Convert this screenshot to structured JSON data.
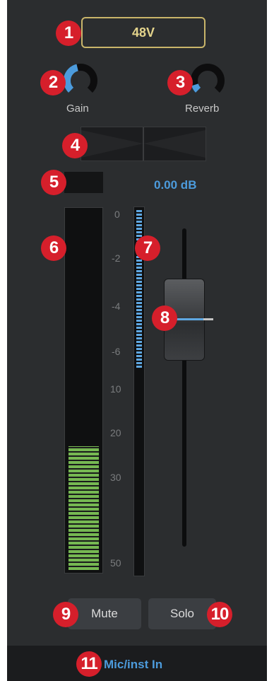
{
  "strip": {
    "phantom_power_label": "48V",
    "gain_label": "Gain",
    "gain_level": 0.45,
    "reverb_label": "Reverb",
    "reverb_level": 0.1,
    "fader_db": "0.00 dB",
    "input_meter_level": 0.34,
    "fader_meter_level": 0.43,
    "scale_ticks": [
      "0",
      "-2",
      "-4",
      "-6",
      "10",
      "20",
      "30",
      "50"
    ],
    "mute_label": "Mute",
    "solo_label": "Solo",
    "input_source_label": "Mic/inst In"
  },
  "callouts": [
    "1",
    "2",
    "3",
    "4",
    "5",
    "6",
    "7",
    "8",
    "9",
    "10",
    "11"
  ],
  "colors": {
    "panel_bg": "#2b2d2f",
    "accent_blue": "#4c9bdc",
    "phantom_gold": "#c9b56a",
    "meter_green": "#76b852",
    "callout_red": "#d61f2b"
  }
}
